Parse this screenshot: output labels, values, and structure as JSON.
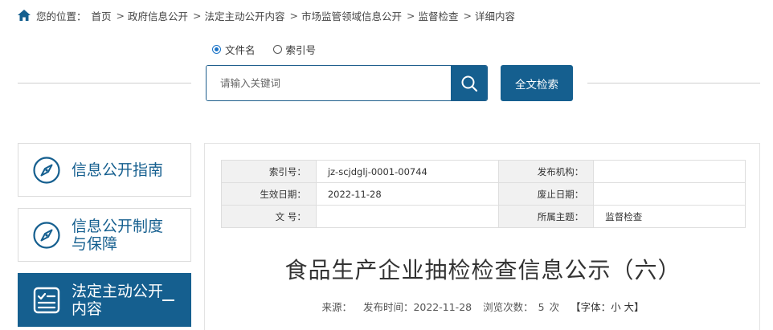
{
  "breadcrumb": {
    "prefix": "您的位置：",
    "items": [
      "首页",
      "政府信息公开",
      "法定主动公开内容",
      "市场监管领域信息公开",
      "监督检查",
      "详细内容"
    ]
  },
  "search": {
    "options": [
      "文件名",
      "索引号"
    ],
    "selected": "文件名",
    "placeholder": "请输入关键词",
    "fulltext_label": "全文检索"
  },
  "sidebar": {
    "items": [
      {
        "label": "信息公开指南",
        "icon": "compass-icon",
        "active": false
      },
      {
        "label": "信息公开制度与保障",
        "icon": "compass-icon",
        "active": false
      },
      {
        "label": "法定主动公开内容",
        "icon": "checklist-icon",
        "active": true,
        "expanded_mark": "—"
      }
    ]
  },
  "meta": {
    "rows": [
      [
        {
          "k": "索引号：",
          "v": "jz-scjdglj-0001-00744"
        },
        {
          "k": "发布机构：",
          "v": ""
        }
      ],
      [
        {
          "k": "生效日期：",
          "v": "2022-11-28"
        },
        {
          "k": "废止日期：",
          "v": ""
        }
      ],
      [
        {
          "k": "文  号：",
          "v": ""
        },
        {
          "k": "所属主题：",
          "v": "监督检查"
        }
      ]
    ]
  },
  "document": {
    "title": "食品生产企业抽检检查信息公示（六）",
    "source_label": "来源：",
    "publish_label": "发布时间：2022-11-28",
    "views_label": "浏览次数：",
    "views_count": "5",
    "views_unit": "次",
    "font_size_label": "【字体：小 大】"
  },
  "colors": {
    "primary": "#155f8f",
    "accent": "#1a73c7"
  }
}
